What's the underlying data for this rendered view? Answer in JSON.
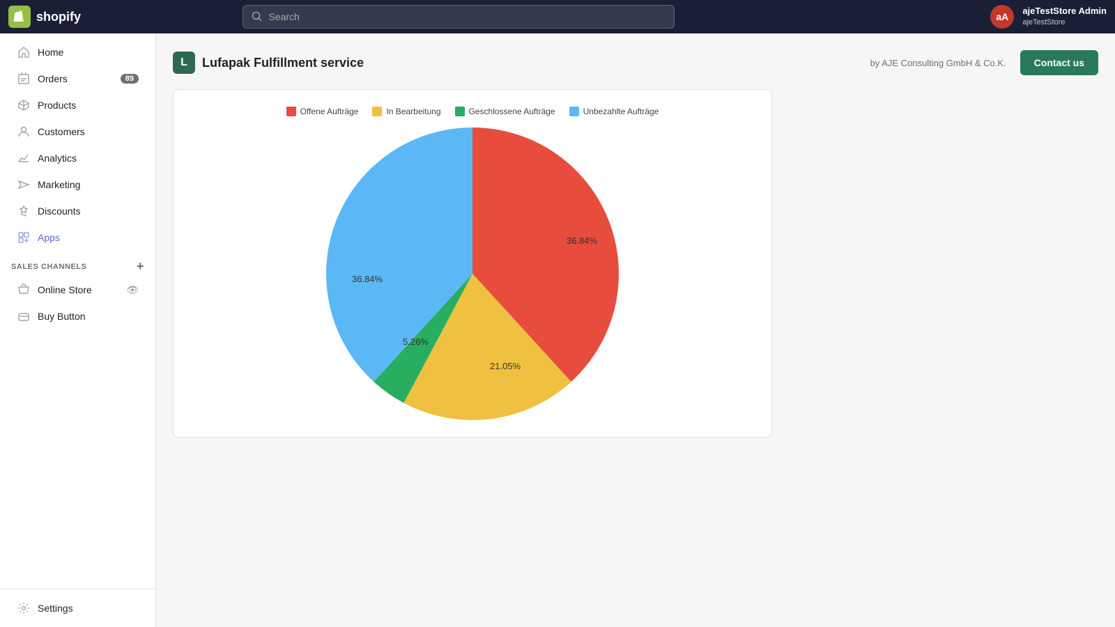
{
  "topnav": {
    "logo_text": "shopify",
    "logo_symbol": "S",
    "search_placeholder": "Search",
    "user_admin": "ajeTestStore Admin",
    "user_store": "ajeTestStore",
    "avatar_initials": "aA"
  },
  "sidebar": {
    "nav_items": [
      {
        "id": "home",
        "label": "Home",
        "icon": "home"
      },
      {
        "id": "orders",
        "label": "Orders",
        "icon": "orders",
        "badge": "89"
      },
      {
        "id": "products",
        "label": "Products",
        "icon": "products"
      },
      {
        "id": "customers",
        "label": "Customers",
        "icon": "customers"
      },
      {
        "id": "analytics",
        "label": "Analytics",
        "icon": "analytics"
      },
      {
        "id": "marketing",
        "label": "Marketing",
        "icon": "marketing"
      },
      {
        "id": "discounts",
        "label": "Discounts",
        "icon": "discounts"
      },
      {
        "id": "apps",
        "label": "Apps",
        "icon": "apps"
      }
    ],
    "sales_channels_label": "SALES CHANNELS",
    "sales_channels": [
      {
        "id": "online-store",
        "label": "Online Store"
      },
      {
        "id": "buy-button",
        "label": "Buy Button"
      }
    ],
    "settings_label": "Settings"
  },
  "app": {
    "logo_letter": "L",
    "title": "Lufapak Fulfillment service",
    "by_text": "by AJE Consulting GmbH & Co.K.",
    "contact_button": "Contact us"
  },
  "chart": {
    "legend": [
      {
        "label": "Offene Aufträge",
        "color": "#e74c3c"
      },
      {
        "label": "In Bearbeitung",
        "color": "#f0c040"
      },
      {
        "label": "Geschlossene Aufträge",
        "color": "#27ae60"
      },
      {
        "label": "Unbezahlte Aufträge",
        "color": "#5bb8f5"
      }
    ],
    "segments": [
      {
        "label": "Offene Aufträge",
        "pct": "36.84%",
        "value": 36.84,
        "color": "#e74c3c"
      },
      {
        "label": "In Bearbeitung",
        "pct": "21.05%",
        "value": 21.05,
        "color": "#f0c040"
      },
      {
        "label": "Geschlossene Aufträge",
        "pct": "5.26%",
        "value": 5.26,
        "color": "#27ae60"
      },
      {
        "label": "Unbezahlte Aufträge",
        "pct": "36.84%",
        "value": 36.84,
        "color": "#5bb8f5"
      }
    ]
  }
}
